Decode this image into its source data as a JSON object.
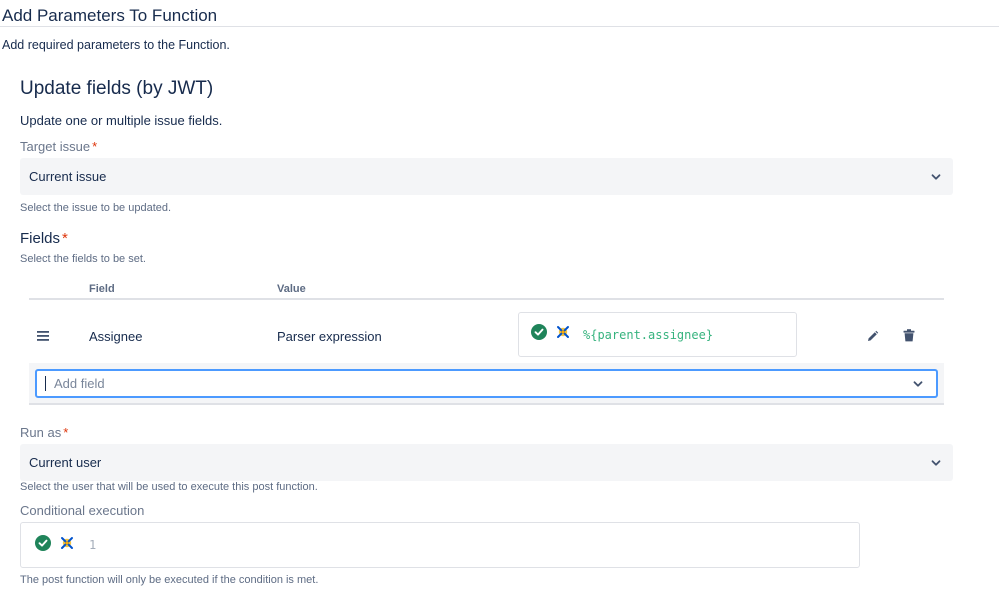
{
  "page": {
    "title": "Add Parameters To Function",
    "description": "Add required parameters to the Function."
  },
  "function": {
    "title": "Update fields (by JWT)",
    "description": "Update one or multiple issue fields."
  },
  "target_issue": {
    "label": "Target issue",
    "required_mark": "*",
    "value": "Current issue",
    "help": "Select the issue to be updated."
  },
  "fields": {
    "heading": "Fields",
    "required_mark": "*",
    "help": "Select the fields to be set.",
    "columns": [
      "Field",
      "Value"
    ],
    "rows": [
      {
        "field": "Assignee",
        "value_type": "Parser expression",
        "expression": "%{parent.assignee}",
        "status_icon": "check-circle-icon",
        "mode_icon": "jwt-parser-icon"
      }
    ],
    "add_placeholder": "Add field"
  },
  "run_as": {
    "label": "Run as",
    "required_mark": "*",
    "value": "Current user",
    "help": "Select the user that will be used to execute this post function."
  },
  "conditional": {
    "label": "Conditional execution",
    "value": "1",
    "help": "The post function will only be executed if the condition is met."
  },
  "colors": {
    "success": "#1f845a",
    "required": "#de350b",
    "focus": "#4c9aff",
    "expression": "#36b37e"
  }
}
